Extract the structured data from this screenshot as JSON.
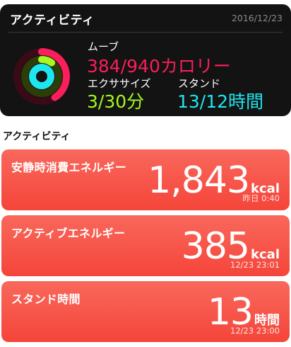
{
  "summary": {
    "title": "アクティビティ",
    "date": "2016/12/23",
    "move_label": "ムーブ",
    "move_value": "384/940カロリー",
    "exercise_label": "エクササイズ",
    "exercise_value": "3/30分",
    "stand_label": "スタンド",
    "stand_value": "13/12時間",
    "rings": {
      "move_progress": 0.41,
      "exercise_progress": 0.1,
      "stand_progress": 1.0
    },
    "colors": {
      "move": "#fa1e5a",
      "exercise": "#a6f81f",
      "stand": "#1ee6ee"
    }
  },
  "section_title": "アクティビティ",
  "cards": [
    {
      "title": "安静時消費エネルギー",
      "value": "1,843",
      "unit": "kcal",
      "timestamp": "昨日 0:40"
    },
    {
      "title": "アクティブエネルギー",
      "value": "385",
      "unit": "kcal",
      "timestamp": "12/23 23:01"
    },
    {
      "title": "スタンド時間",
      "value": "13",
      "unit": "時間",
      "timestamp": "12/23 23:00"
    }
  ]
}
